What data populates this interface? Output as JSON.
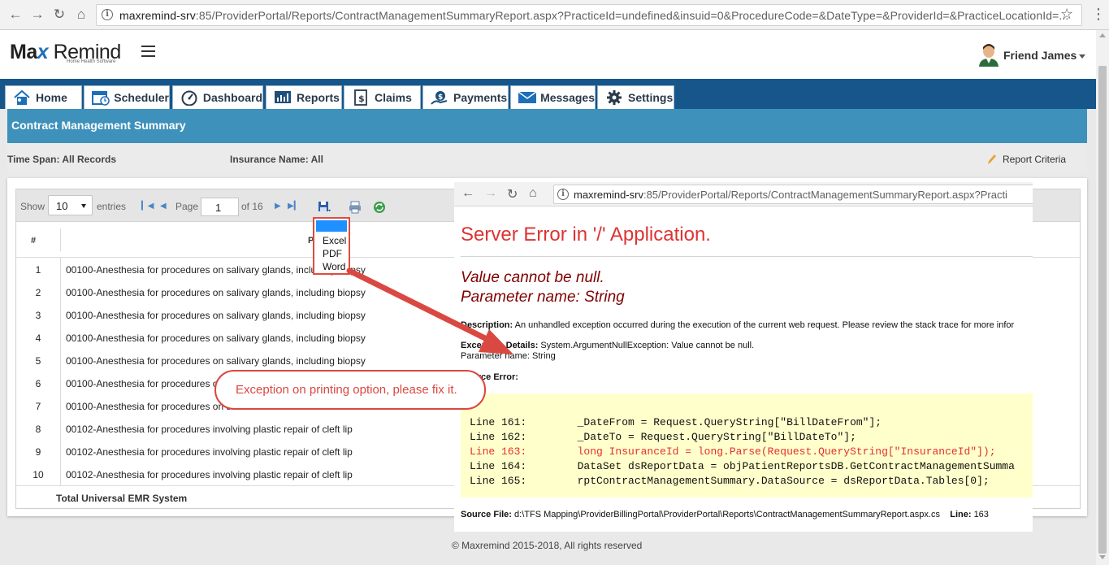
{
  "browser": {
    "url_host": "maxremind-srv",
    "url_rest": ":85/ProviderPortal/Reports/ContractManagementSummaryReport.aspx?PracticeId=undefined&insuid=0&ProcedureCode=&DateType=&ProviderId=&PracticeLocationId=..."
  },
  "header": {
    "logo_max": "Ma",
    "logo_x": "x",
    "logo_remind": "Remind",
    "logo_tagline": "Home Health Software",
    "user_name": "Friend James"
  },
  "nav": {
    "tabs": [
      {
        "label": "Home",
        "icon": "home-icon"
      },
      {
        "label": "Scheduler",
        "icon": "calendar-icon"
      },
      {
        "label": "Dashboard",
        "icon": "gauge-icon"
      },
      {
        "label": "Reports",
        "icon": "report-icon"
      },
      {
        "label": "Claims",
        "icon": "claims-icon"
      },
      {
        "label": "Payments",
        "icon": "payments-icon"
      },
      {
        "label": "Messages",
        "icon": "envelope-icon"
      },
      {
        "label": "Settings",
        "icon": "gear-icon"
      }
    ]
  },
  "report": {
    "title": "Contract Management Summary",
    "time_span": "Time Span: All Records",
    "insurance_name": "Insurance Name: All",
    "criteria_label": "Report Criteria"
  },
  "grid": {
    "show_label": "Show",
    "entries_value": "10",
    "entries_label": "entries",
    "page_label": "Page",
    "page_value": "1",
    "of_pages": "of 16",
    "col_hash": "#",
    "col_procedure": "P",
    "rows": [
      {
        "n": "1",
        "desc": "00100-Anesthesia for procedures on salivary glands, including biopsy"
      },
      {
        "n": "2",
        "desc": "00100-Anesthesia for procedures on salivary glands, including biopsy"
      },
      {
        "n": "3",
        "desc": "00100-Anesthesia for procedures on salivary glands, including biopsy"
      },
      {
        "n": "4",
        "desc": "00100-Anesthesia for procedures on salivary glands, including biopsy"
      },
      {
        "n": "5",
        "desc": "00100-Anesthesia for procedures on salivary glands, including biopsy"
      },
      {
        "n": "6",
        "desc": "00100-Anesthesia for procedures on salivary glands, including biopsy"
      },
      {
        "n": "7",
        "desc": "00100-Anesthesia for procedures on sa"
      },
      {
        "n": "8",
        "desc": "00102-Anesthesia for procedures involving plastic repair of cleft lip"
      },
      {
        "n": "9",
        "desc": "00102-Anesthesia for procedures involving plastic repair of cleft lip"
      },
      {
        "n": "10",
        "desc": "00102-Anesthesia for procedures involving plastic repair of cleft lip"
      }
    ],
    "total_label": "Total Universal EMR System"
  },
  "export_menu": {
    "options": [
      "Excel",
      "PDF",
      "Word"
    ]
  },
  "footer": "© Maxremind 2015-2018, All rights reserved",
  "error_page": {
    "url_host": "maxremind-srv",
    "url_rest": ":85/ProviderPortal/Reports/ContractManagementSummaryReport.aspx?Practi",
    "title": "Server Error in '/' Application.",
    "message": "Value cannot be null.",
    "param": "Parameter name: String",
    "desc_label": "Description:",
    "desc_text": "An unhandled exception occurred during the execution of the current web request. Please review the stack trace for more infor",
    "exc_label": "Exception Details:",
    "exc_text": "System.ArgumentNullException: Value cannot be null.",
    "exc_param": "Parameter name: String",
    "source_label": "Source Error:",
    "code_lines": [
      "Line 161:        _DateFrom = Request.QueryString[\"BillDateFrom\"];",
      "Line 162:        _DateTo = Request.QueryString[\"BillDateTo\"];",
      "Line 163:        long InsuranceId = long.Parse(Request.QueryString[\"InsuranceId\"]);",
      "Line 164:        DataSet dsReportData = objPatientReportsDB.GetContractManagementSumma",
      "Line 165:        rptContractManagementSummary.DataSource = dsReportData.Tables[0];"
    ],
    "source_file_label": "Source File:",
    "source_file": "d:\\TFS Mapping\\ProviderBillingPortal\\ProviderPortal\\Reports\\ContractManagementSummaryReport.aspx.cs",
    "line_label": "Line:",
    "line_value": "163"
  },
  "annotation": {
    "text": "Exception on printing option, please fix it."
  },
  "colors": {
    "navbar": "#16568a",
    "content_header": "#3e91bb",
    "error_red": "#d33333",
    "annotation_red": "#d94841",
    "code_bg": "#ffffcc"
  }
}
